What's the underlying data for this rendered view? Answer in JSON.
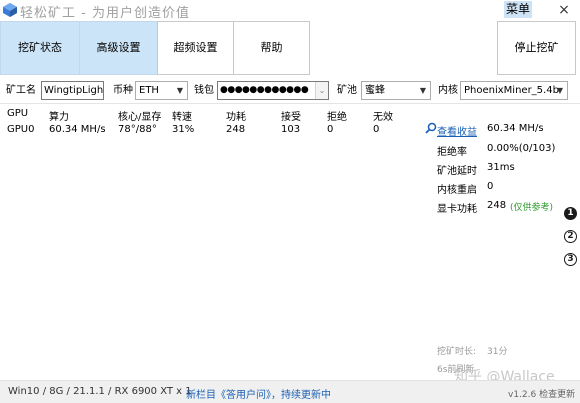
{
  "window": {
    "title": "轻松矿工 - 为用户创造价值",
    "menu_label": "菜单",
    "close_glyph": "×"
  },
  "toolbar": {
    "tabs": [
      {
        "label": "挖矿状态"
      },
      {
        "label": "高级设置"
      },
      {
        "label": "超频设置"
      },
      {
        "label": "帮助"
      }
    ],
    "stop_label": "停止挖矿"
  },
  "config": {
    "worker_label": "矿工名",
    "worker_value": "WingtipLight",
    "coin_label": "币种",
    "coin_value": "ETH",
    "wallet_label": "钱包",
    "wallet_value": "●●●●●●●●●●●●",
    "pool_label": "矿池",
    "pool_value": "蜜蜂",
    "kernel_label": "内核",
    "kernel_value": "PhoenixMiner_5.4b"
  },
  "gpu_table": {
    "headers": [
      "GPU",
      "算力",
      "核心/显存",
      "转速",
      "功耗",
      "接受",
      "拒绝",
      "无效"
    ],
    "rows": [
      [
        "GPU0",
        "60.34 MH/s",
        "78°/88°",
        "31%",
        "248",
        "103",
        "0",
        "0"
      ]
    ]
  },
  "stats": {
    "earnings_link": "查看收益",
    "hashrate_value": "60.34 MH/s",
    "reject_label": "拒绝率",
    "reject_value": "0.00%(0/103)",
    "latency_label": "矿池延时",
    "latency_value": "31ms",
    "restart_label": "内核重启",
    "restart_value": "0",
    "power_label": "显卡功耗",
    "power_value": "248",
    "power_note": "(仅供参考)",
    "mining_time_label": "挖矿时长:",
    "mining_time_value": "31分",
    "restart_ago": "6s前刷新"
  },
  "side_numbers": [
    "1",
    "2",
    "3"
  ],
  "status": {
    "system": "Win10  /  8G  /  21.1.1  /  RX 6900 XT x 1",
    "news": "新栏目《答用户问》，持续更新中",
    "version": "v1.2.6 检查更新",
    "watermark": "知乎 @Wallace"
  },
  "colors": {
    "accent_tab": "#cce4f7",
    "link": "#1a5fb4",
    "note_green": "#2d9a2d"
  }
}
